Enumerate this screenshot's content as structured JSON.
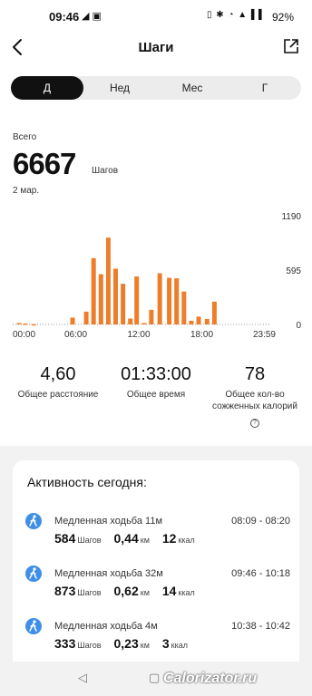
{
  "status_bar": {
    "time": "09:46",
    "left_icons": "◢ ▣",
    "right_icons": "▯ ✱ ◔ ▲ ▌▌",
    "battery": "92%"
  },
  "header": {
    "title": "Шаги",
    "back_icon": "arrow-left-icon",
    "share_icon": "share-icon"
  },
  "tabs": [
    {
      "label": "Д",
      "active": true
    },
    {
      "label": "Нед",
      "active": false
    },
    {
      "label": "Мес",
      "active": false
    },
    {
      "label": "Г",
      "active": false
    }
  ],
  "summary": {
    "total_label": "Всего",
    "steps": "6667",
    "unit": "Шагов",
    "date": "2 мар."
  },
  "chart_data": {
    "type": "bar",
    "bar_color": "#ee7d2a",
    "x_ticks": [
      "00:00",
      "06:00",
      "12:00",
      "18:00",
      "23:59"
    ],
    "y_ticks": [
      "1190",
      "595",
      "0"
    ],
    "ylim": [
      0,
      1190
    ],
    "x_range": [
      0,
      24
    ],
    "x": [
      0.6,
      1.2,
      2.0,
      5.7,
      7.0,
      7.7,
      8.4,
      9.1,
      9.8,
      10.5,
      11.2,
      11.8,
      12.5,
      13.2,
      14.0,
      14.9,
      15.6,
      16.3,
      17.0,
      17.7,
      18.5,
      19.2,
      20.0,
      20.8,
      21.5,
      22.3
    ],
    "values": [
      15,
      10,
      3,
      75,
      140,
      725,
      550,
      950,
      610,
      445,
      65,
      525,
      15,
      160,
      560,
      510,
      505,
      360,
      40,
      85,
      60,
      250,
      0,
      0,
      0,
      0
    ]
  },
  "stats": [
    {
      "value": "4,60",
      "label": "Общее расстояние"
    },
    {
      "value": "01:33:00",
      "label": "Общее время"
    },
    {
      "value": "78",
      "label": "Общее кол-во сожженных калорий",
      "help": "?"
    }
  ],
  "activity": {
    "title": "Активность сегодня:",
    "items": [
      {
        "name": "Медленная ходьба 11м",
        "range": "08:09 - 08:20",
        "steps": "584",
        "steps_unit": "Шагов",
        "distance": "0,44",
        "distance_unit": "км",
        "kcal": "12",
        "kcal_unit": "ккал",
        "icon": "walking-icon"
      },
      {
        "name": "Медленная ходьба 32м",
        "range": "09:46 - 10:18",
        "steps": "873",
        "steps_unit": "Шагов",
        "distance": "0,62",
        "distance_unit": "км",
        "kcal": "14",
        "kcal_unit": "ккал",
        "icon": "walking-icon"
      },
      {
        "name": "Медленная ходьба 4м",
        "range": "10:38 - 10:42",
        "steps": "333",
        "steps_unit": "Шагов",
        "distance": "0,23",
        "distance_unit": "км",
        "kcal": "3",
        "kcal_unit": "ккал",
        "icon": "walking-icon"
      }
    ]
  },
  "nav": {
    "back": "◁",
    "home": "▢"
  },
  "watermark": "Calorizator.ru"
}
